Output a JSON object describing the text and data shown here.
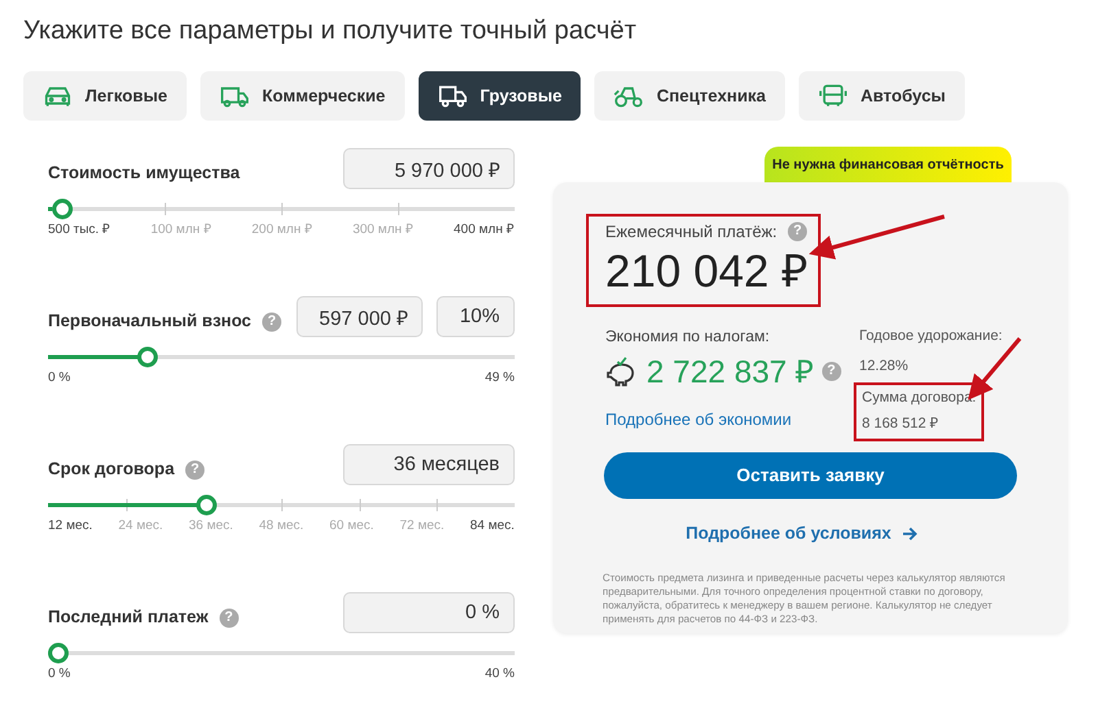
{
  "heading": "Укажите все параметры и получите точный расчёт",
  "tabs": [
    {
      "label": "Легковые",
      "selected": false
    },
    {
      "label": "Коммерческие",
      "selected": false
    },
    {
      "label": "Грузовые",
      "selected": true
    },
    {
      "label": "Спецтехника",
      "selected": false
    },
    {
      "label": "Автобусы",
      "selected": false
    }
  ],
  "params": [
    {
      "label": "Стоимость имущества",
      "fields": [
        "5 970 000 ₽"
      ],
      "level": 0.01,
      "scale": [
        "500 тыс. ₽",
        "100 млн ₽",
        "200 млн ₽",
        "300 млн ₽",
        "400 млн ₽"
      ]
    },
    {
      "label": "Первоначальный взнос",
      "help": "?",
      "fields": [
        "597 000 ₽",
        "10%"
      ],
      "level": 0.2,
      "scale": [
        "0 %",
        "49 %"
      ]
    },
    {
      "label": "Срок договора",
      "help": "?",
      "fields": [
        "36 месяцев"
      ],
      "level": 0.333,
      "scale": [
        "12 мес.",
        "24 мес.",
        "36 мес.",
        "48 мес.",
        "60 мес.",
        "72 мес.",
        "84 мес."
      ]
    },
    {
      "label": "Последний платеж",
      "help": "?",
      "fields": [
        "0 %"
      ],
      "level": 0,
      "scale": [
        "0 %",
        "40 %"
      ]
    }
  ],
  "result": {
    "badge": "Не нужна финансовая отчётность",
    "monthly": {
      "label": "Ежемесячный платёж:",
      "help": "?",
      "value": "210 042 ₽",
      "highlighted": true
    },
    "savings": {
      "label": "Экономия по налогам:",
      "value": "2 722 837 ₽",
      "help": "?",
      "link": "Подробнее об экономии"
    },
    "annual": {
      "label": "Годовое удорожание:",
      "value": "12.28%"
    },
    "contract": {
      "label": "Сумма договора:",
      "value": "8 168 512 ₽",
      "highlighted": true
    },
    "button": "Оставить заявку",
    "details_link": "Подробнее об условиях",
    "disclaimer": "Стоимость предмета лизинга и приведенные расчеты через калькулятор являются предварительными. Для точного определения процентной ставки по договору, пожалуйста, обратитесь к менеджеру в вашем регионе. Калькулятор не следует применять для расчетов по 44-ФЗ и 223-ФЗ."
  }
}
